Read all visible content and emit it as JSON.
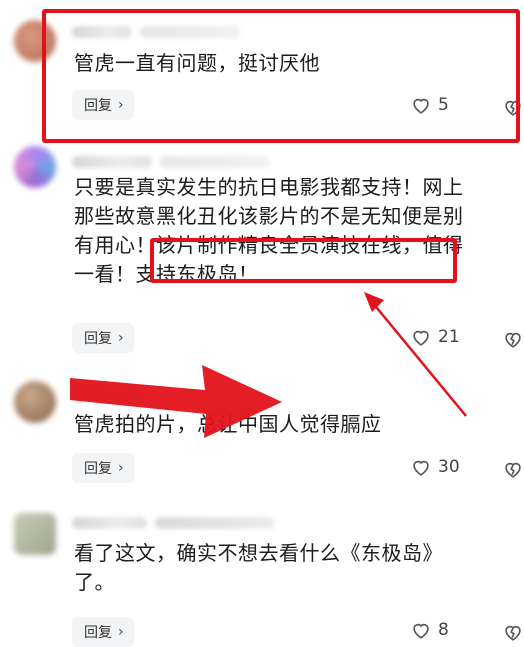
{
  "comments": [
    {
      "text": "管虎一直有问题，挺讨厌他",
      "reply_label": "回复",
      "likes": "5",
      "avatar_color": "#c9826b"
    },
    {
      "text": "只要是真实发生的抗日电影我都支持！网上\n那些故意黑化丑化该影片的不是无知便是别\n有用心！该片制作精良全员演技在线，值得\n一看！支持东极岛！",
      "reply_label": "回复",
      "likes": "21",
      "avatar_color": "#8f6bd6"
    },
    {
      "text": "管虎拍的片，总让中国人觉得膈应",
      "reply_label": "回复",
      "likes": "30",
      "avatar_color": "#a8866a"
    },
    {
      "text": "看了这文，确实不想去看什么《东极岛》\n了。",
      "reply_label": "回复",
      "likes": "8",
      "avatar_color": "#b7bca6"
    }
  ],
  "colors": {
    "annotation_red": "#e3121a",
    "reply_bg": "#f3f4f6"
  },
  "icons": {
    "like": "heart-outline-icon",
    "dislike": "broken-heart-icon",
    "reply_chevron": "chevron-right-icon"
  }
}
